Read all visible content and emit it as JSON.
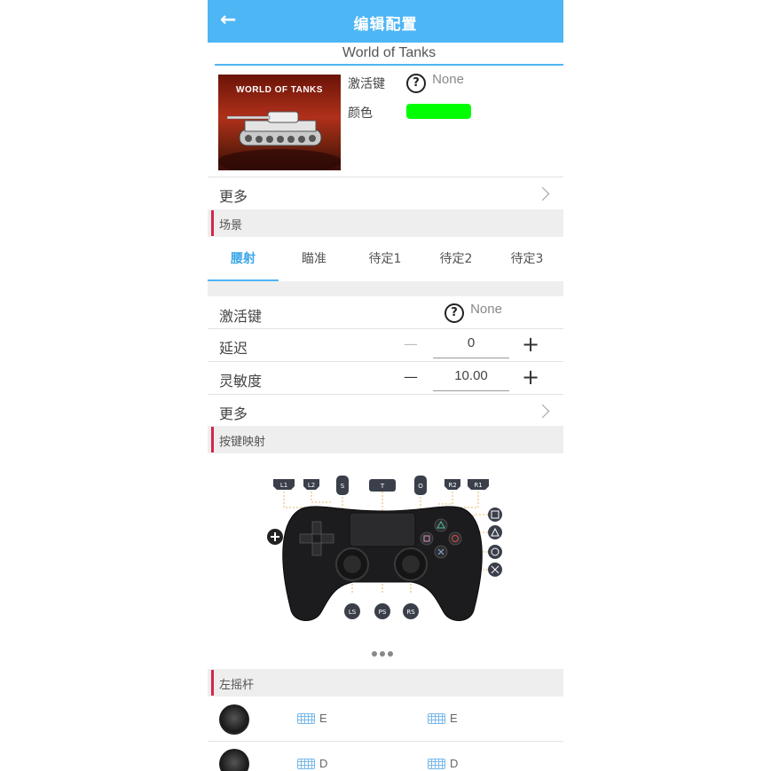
{
  "header": {
    "back_icon": "←",
    "title": "编辑配置"
  },
  "game": {
    "name": "World of Tanks",
    "cover_logo": "WORLD OF TANKS"
  },
  "info": {
    "activation_label": "激活键",
    "activation_value": "None",
    "color_label": "颜色",
    "color_value": "#00ff00"
  },
  "more_label": "更多",
  "scene": {
    "header": "场景",
    "tabs": [
      {
        "label": "腰射",
        "active": true
      },
      {
        "label": "瞄准",
        "active": false
      },
      {
        "label": "待定1",
        "active": false
      },
      {
        "label": "待定2",
        "active": false
      },
      {
        "label": "待定3",
        "active": false
      }
    ],
    "activation_label": "激活键",
    "activation_value": "None",
    "delay_label": "延迟",
    "delay_value": "0",
    "sensitivity_label": "灵敏度",
    "sensitivity_value": "10.00",
    "minus": "—",
    "plus": "+",
    "more_label": "更多"
  },
  "mapping": {
    "header": "按键映射",
    "top_buttons": [
      "L1",
      "L2",
      "S",
      "T",
      "O",
      "R2",
      "R1"
    ],
    "bottom_buttons": [
      "LS",
      "RS"
    ]
  },
  "left_stick": {
    "header": "左摇杆",
    "rows": [
      {
        "left_key": "E",
        "right_key": "E"
      },
      {
        "left_key": "D",
        "right_key": "D"
      }
    ]
  },
  "colors": {
    "accent": "#4db6f5",
    "section_marker": "#d4264a"
  }
}
